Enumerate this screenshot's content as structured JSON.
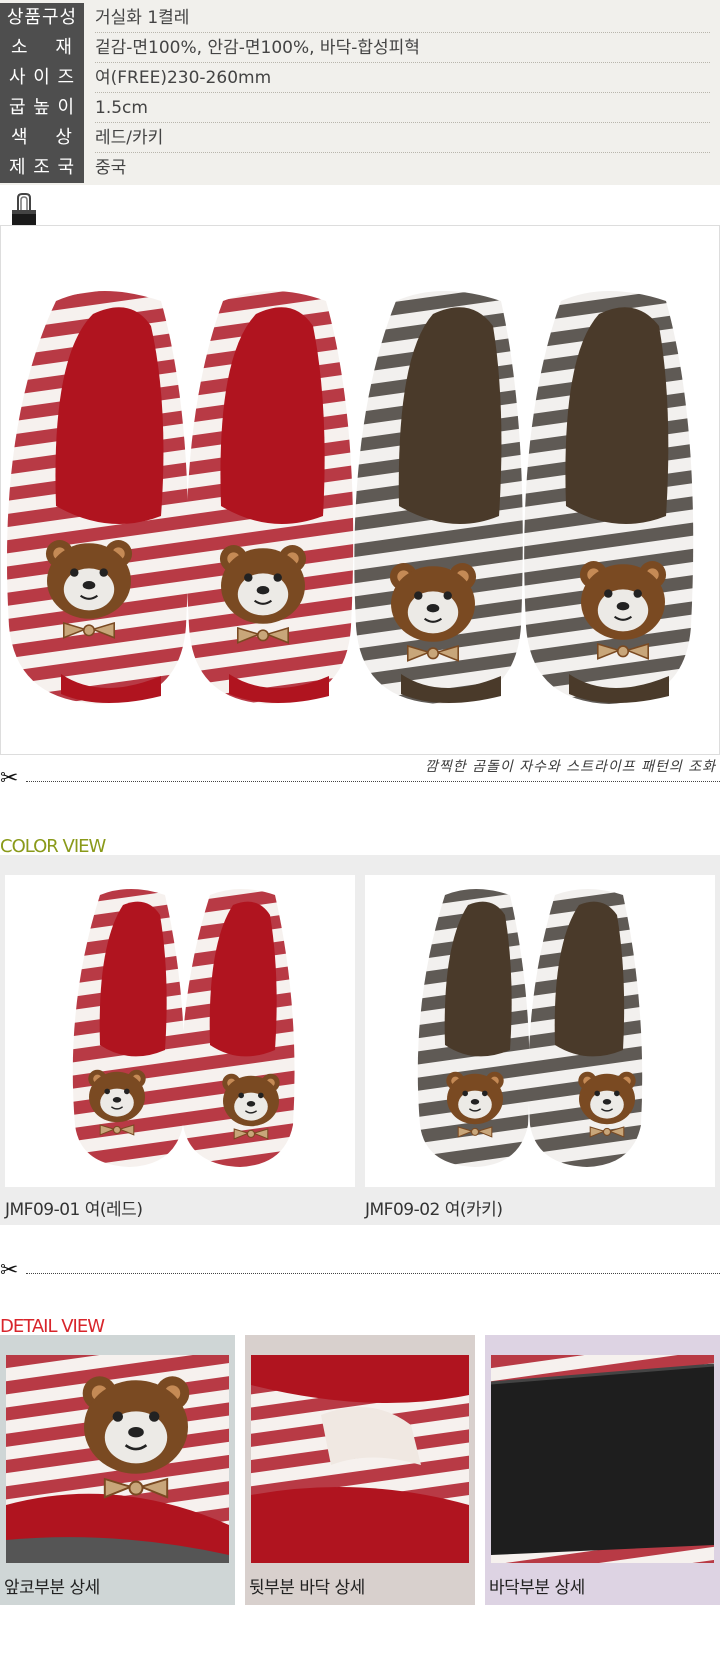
{
  "spec": {
    "rows": [
      {
        "label": "상품구성",
        "value": "거실화 1켤레"
      },
      {
        "label": "소    재",
        "value": "겉감-면100%, 안감-면100%, 바닥-합성피혁"
      },
      {
        "label": "사 이 즈",
        "value": "여(FREE)230-260mm"
      },
      {
        "label": "굽 높 이",
        "value": "1.5cm"
      },
      {
        "label": "색    상",
        "value": "레드/카키"
      },
      {
        "label": "제 조 국",
        "value": "중국"
      }
    ]
  },
  "main": {
    "caption": "깜찍한 곰돌이 자수와 스트라이프 패턴의 조화"
  },
  "color_view": {
    "title": "COLOR VIEW",
    "items": [
      {
        "label": "JMF09-01 여(레드)",
        "stripe": "#b83a45",
        "inner": "#b0141f"
      },
      {
        "label": "JMF09-02 여(카키)",
        "stripe": "#5f5a55",
        "inner": "#4a3a2a"
      }
    ]
  },
  "detail_view": {
    "title": "DETAIL VIEW",
    "items": [
      {
        "label": "앞코부분 상세",
        "bg": "#cfd6d6"
      },
      {
        "label": "뒷부분 바닥 상세",
        "bg": "#d8d0cd"
      },
      {
        "label": "바닥부분 상세",
        "bg": "#ddd3e3"
      }
    ]
  },
  "colors": {
    "red": "#b83a45",
    "khaki": "#5f5a55",
    "bear": "#7a4a22",
    "color_view_title": "#8a9a1a",
    "detail_view_title": "#d8252b"
  }
}
